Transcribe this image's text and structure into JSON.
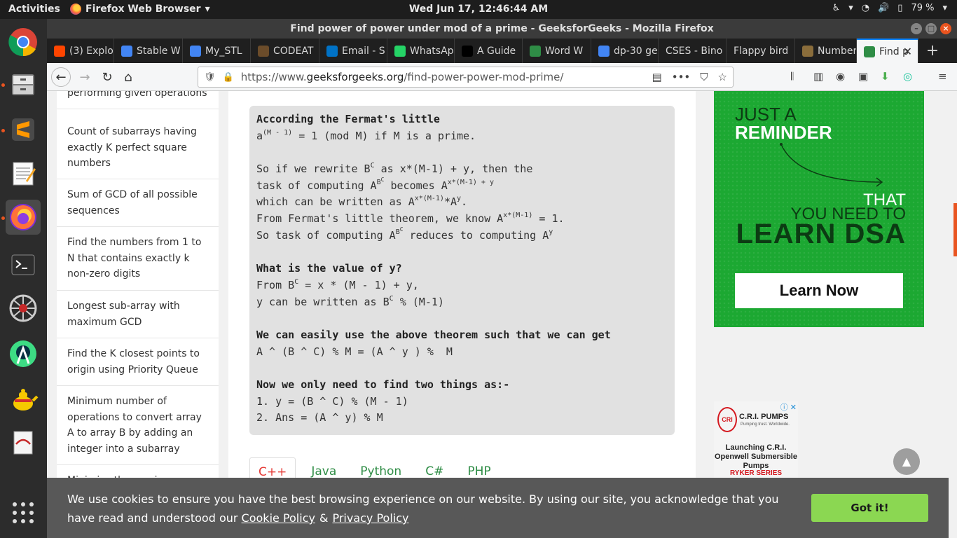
{
  "topbar": {
    "activities": "Activities",
    "app_name": "Firefox Web Browser",
    "clock": "Wed Jun 17, 12:46:44 AM",
    "battery": "79 %"
  },
  "window": {
    "title": "Find power of power under mod of a prime - GeeksforGeeks - Mozilla Firefox"
  },
  "tabs": [
    {
      "label": "(3) Explo",
      "icon": "reddit-icon",
      "color": "#ff4500"
    },
    {
      "label": "Stable W",
      "icon": "google-icon",
      "color": "#4285f4"
    },
    {
      "label": "My_STL",
      "icon": "docs-icon",
      "color": "#4285f4"
    },
    {
      "label": "CODEAT",
      "icon": "codechef-icon",
      "color": "#6b4c2a"
    },
    {
      "label": "Email - S",
      "icon": "outlook-icon",
      "color": "#0072c6"
    },
    {
      "label": "WhatsAp",
      "icon": "whatsapp-icon",
      "color": "#25d366"
    },
    {
      "label": "A Guide",
      "icon": "medium-icon",
      "color": "#000000"
    },
    {
      "label": "Word W",
      "icon": "gfg-icon",
      "color": "#2f8d46"
    },
    {
      "label": "dp-30 ge",
      "icon": "google-icon",
      "color": "#4285f4"
    },
    {
      "label": "CSES - Bino",
      "icon": "",
      "color": ""
    },
    {
      "label": "Flappy bird",
      "icon": "",
      "color": ""
    },
    {
      "label": "Number",
      "icon": "lock-icon",
      "color": "#8a6d3b"
    },
    {
      "label": "Find p",
      "icon": "gfg-icon",
      "color": "#2f8d46"
    }
  ],
  "address": {
    "url_prefix": "https://www.",
    "url_domain": "geeksforgeeks.org",
    "url_path": "/find-power-power-mod-prime/"
  },
  "sidebar": {
    "items": [
      "performing given operations",
      "Count of subarrays having exactly K perfect square numbers",
      "Sum of GCD of all possible sequences",
      "Find the numbers from 1 to N that contains exactly k non-zero digits",
      "Longest sub-array with maximum GCD",
      "Find the K closest points to origin using Priority Queue",
      "Minimum number of operations to convert array A to array B by adding an integer into a subarray",
      "Minimize the maximum"
    ]
  },
  "code": {
    "l1": "According the Fermat's little",
    "l2a": "a",
    "l2sup": "(M - 1)",
    "l2b": " = 1 (mod M) if M is a prime.",
    "l4a": "So if we rewrite B",
    "l4sup": "C",
    "l4b": " as x*(M-1) + y, then the",
    "l5a": "task of computing A",
    "l5sup1": "B",
    "l5sup1b": "C",
    "l5b": " becomes A",
    "l5sup2": "x*(M-1) + y",
    "l6a": "which can be written as A",
    "l6sup1": "x*(M-1)",
    "l6b": "*A",
    "l6sup2": "y",
    "l6c": ".",
    "l7a": "From Fermat's little theorem, we know A",
    "l7sup": "x*(M-1)",
    "l7b": " = 1.",
    "l8a": "So task of computing A",
    "l8sup": "B",
    "l8supb": "C",
    "l8b": " reduces to computing A",
    "l8sup2": "y",
    "l10": "What is the value of y?",
    "l11a": "From B",
    "l11sup": "C",
    "l11b": " = x * (M - 1) + y,",
    "l12a": "y can be written as B",
    "l12sup": "C",
    "l12b": " % (M-1)",
    "l14": "We can easily use the above theorem such that we can get",
    "l15": "A ^ (B ^ C) % M = (A ^ y ) %  M",
    "l17": "Now we only need to find two things as:-",
    "l18": "1. y = (B ^ C) % (M - 1)",
    "l19": "2. Ans = (A ^ y) % M"
  },
  "lang_tabs": [
    "C++",
    "Java",
    "Python",
    "C#",
    "PHP"
  ],
  "ad1": {
    "line1": "JUST A",
    "line2": "REMINDER",
    "line3": "THAT",
    "line4": "YOU NEED TO",
    "line5": "LEARN DSA",
    "button": "Learn Now"
  },
  "ad2": {
    "logo": "CRI",
    "brand": "C.R.I. PUMPS",
    "tagline": "Pumping trust. Worldwide.",
    "body": "Launching C.R.I. Openwell Submersible Pumps",
    "series": "RYKER SERIES"
  },
  "cookie": {
    "text": "We use cookies to ensure you have the best browsing experience on our website. By using our site, you acknowledge that you have read and understood our",
    "cookie_policy": "Cookie Policy",
    "amp": "&",
    "privacy_policy": "Privacy Policy",
    "button": "Got it!"
  },
  "colors": {
    "accent": "#2f8d46",
    "ubuntu_orange": "#e95420",
    "cookie_button": "#8bd752"
  }
}
